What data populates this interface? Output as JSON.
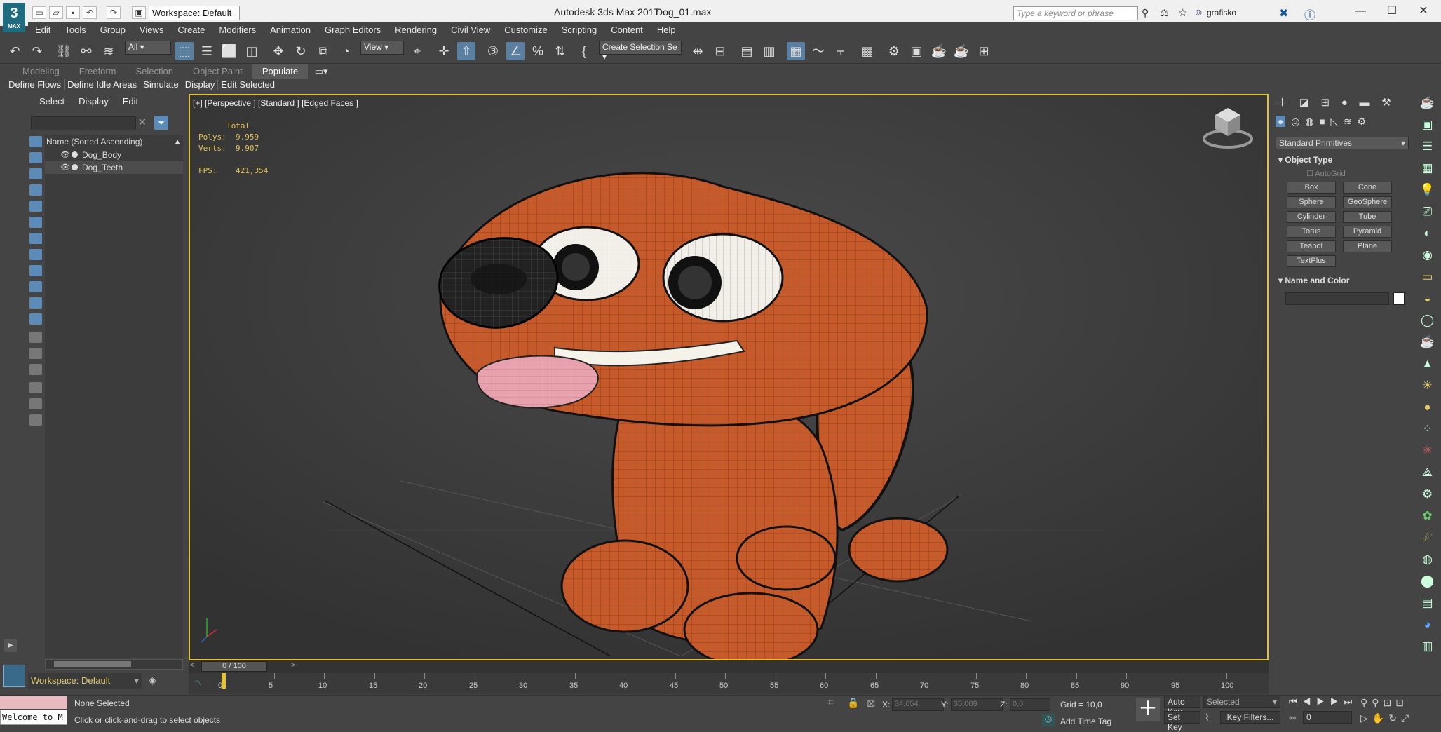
{
  "app": {
    "window_title": "Autodesk 3ds Max 2017",
    "file_name": "Dog_01.max",
    "logo_text": "3",
    "logo_sub": "MAX"
  },
  "workspace": {
    "label": "Workspace: Default"
  },
  "search": {
    "placeholder": "Type a keyword or phrase"
  },
  "user": {
    "name": "grafisko"
  },
  "menu": [
    "Edit",
    "Tools",
    "Group",
    "Views",
    "Create",
    "Modifiers",
    "Animation",
    "Graph Editors",
    "Rendering",
    "Civil View",
    "Customize",
    "Scripting",
    "Content",
    "Help"
  ],
  "toolbar": {
    "filter_value": "All",
    "coord_value": "View",
    "selection_set": "Create Selection Se"
  },
  "ribbon": {
    "tabs": [
      "Modeling",
      "Freeform",
      "Selection",
      "Object Paint",
      "Populate"
    ],
    "active": "Populate",
    "subtabs": [
      "Define Flows",
      "Define Idle Areas",
      "Simulate",
      "Display",
      "Edit Selected"
    ]
  },
  "scene_explorer": {
    "tabs": [
      "Select",
      "Display",
      "Edit"
    ],
    "column_header": "Name (Sorted Ascending)",
    "items": [
      "Dog_Body",
      "Dog_Teeth"
    ]
  },
  "viewport": {
    "label": "[+] [Perspective ] [Standard ] [Edged Faces ]",
    "stats_header": "Total",
    "polys_label": "Polys:",
    "polys": "9.959",
    "verts_label": "Verts:",
    "verts": "9.907",
    "fps_label": "FPS:",
    "fps": "421,354"
  },
  "timeline": {
    "frame": "0 / 100",
    "ticks": [
      "0",
      "5",
      "10",
      "15",
      "20",
      "25",
      "30",
      "35",
      "40",
      "45",
      "50",
      "55",
      "60",
      "65",
      "70",
      "75",
      "80",
      "85",
      "90",
      "95",
      "100"
    ]
  },
  "command_panel": {
    "dropdown": "Standard Primitives",
    "object_type_title": "Object Type",
    "autogrid": "AutoGrid",
    "buttons": [
      "Box",
      "Cone",
      "Sphere",
      "GeoSphere",
      "Cylinder",
      "Tube",
      "Torus",
      "Pyramid",
      "Teapot",
      "Plane",
      "TextPlus"
    ],
    "name_color_title": "Name and Color"
  },
  "status": {
    "selection": "None Selected",
    "hint": "Click or click-and-drag to select objects",
    "maxscript": "Welcome to M",
    "x_label": "X:",
    "x": "34,654",
    "y_label": "Y:",
    "y": "36,009",
    "z_label": "Z:",
    "z": "0,0",
    "grid": "Grid = 10,0",
    "add_time_tag": "Add Time Tag",
    "auto_key": "Auto Key",
    "set_key": "Set Key",
    "selected": "Selected",
    "key_filters": "Key Filters...",
    "frame_input": "0"
  },
  "colors": {
    "accent": "#e4c23a",
    "dog": "#c65a2b",
    "tongue": "#e8a2ae"
  }
}
